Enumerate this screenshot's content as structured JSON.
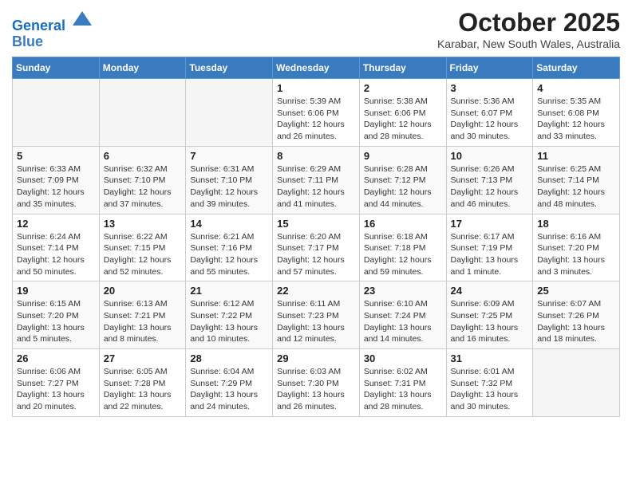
{
  "header": {
    "logo_line1": "General",
    "logo_line2": "Blue",
    "title": "October 2025",
    "location": "Karabar, New South Wales, Australia"
  },
  "weekdays": [
    "Sunday",
    "Monday",
    "Tuesday",
    "Wednesday",
    "Thursday",
    "Friday",
    "Saturday"
  ],
  "weeks": [
    [
      {
        "day": "",
        "info": ""
      },
      {
        "day": "",
        "info": ""
      },
      {
        "day": "",
        "info": ""
      },
      {
        "day": "1",
        "info": "Sunrise: 5:39 AM\nSunset: 6:06 PM\nDaylight: 12 hours\nand 26 minutes."
      },
      {
        "day": "2",
        "info": "Sunrise: 5:38 AM\nSunset: 6:06 PM\nDaylight: 12 hours\nand 28 minutes."
      },
      {
        "day": "3",
        "info": "Sunrise: 5:36 AM\nSunset: 6:07 PM\nDaylight: 12 hours\nand 30 minutes."
      },
      {
        "day": "4",
        "info": "Sunrise: 5:35 AM\nSunset: 6:08 PM\nDaylight: 12 hours\nand 33 minutes."
      }
    ],
    [
      {
        "day": "5",
        "info": "Sunrise: 6:33 AM\nSunset: 7:09 PM\nDaylight: 12 hours\nand 35 minutes."
      },
      {
        "day": "6",
        "info": "Sunrise: 6:32 AM\nSunset: 7:10 PM\nDaylight: 12 hours\nand 37 minutes."
      },
      {
        "day": "7",
        "info": "Sunrise: 6:31 AM\nSunset: 7:10 PM\nDaylight: 12 hours\nand 39 minutes."
      },
      {
        "day": "8",
        "info": "Sunrise: 6:29 AM\nSunset: 7:11 PM\nDaylight: 12 hours\nand 41 minutes."
      },
      {
        "day": "9",
        "info": "Sunrise: 6:28 AM\nSunset: 7:12 PM\nDaylight: 12 hours\nand 44 minutes."
      },
      {
        "day": "10",
        "info": "Sunrise: 6:26 AM\nSunset: 7:13 PM\nDaylight: 12 hours\nand 46 minutes."
      },
      {
        "day": "11",
        "info": "Sunrise: 6:25 AM\nSunset: 7:14 PM\nDaylight: 12 hours\nand 48 minutes."
      }
    ],
    [
      {
        "day": "12",
        "info": "Sunrise: 6:24 AM\nSunset: 7:14 PM\nDaylight: 12 hours\nand 50 minutes."
      },
      {
        "day": "13",
        "info": "Sunrise: 6:22 AM\nSunset: 7:15 PM\nDaylight: 12 hours\nand 52 minutes."
      },
      {
        "day": "14",
        "info": "Sunrise: 6:21 AM\nSunset: 7:16 PM\nDaylight: 12 hours\nand 55 minutes."
      },
      {
        "day": "15",
        "info": "Sunrise: 6:20 AM\nSunset: 7:17 PM\nDaylight: 12 hours\nand 57 minutes."
      },
      {
        "day": "16",
        "info": "Sunrise: 6:18 AM\nSunset: 7:18 PM\nDaylight: 12 hours\nand 59 minutes."
      },
      {
        "day": "17",
        "info": "Sunrise: 6:17 AM\nSunset: 7:19 PM\nDaylight: 13 hours\nand 1 minute."
      },
      {
        "day": "18",
        "info": "Sunrise: 6:16 AM\nSunset: 7:20 PM\nDaylight: 13 hours\nand 3 minutes."
      }
    ],
    [
      {
        "day": "19",
        "info": "Sunrise: 6:15 AM\nSunset: 7:20 PM\nDaylight: 13 hours\nand 5 minutes."
      },
      {
        "day": "20",
        "info": "Sunrise: 6:13 AM\nSunset: 7:21 PM\nDaylight: 13 hours\nand 8 minutes."
      },
      {
        "day": "21",
        "info": "Sunrise: 6:12 AM\nSunset: 7:22 PM\nDaylight: 13 hours\nand 10 minutes."
      },
      {
        "day": "22",
        "info": "Sunrise: 6:11 AM\nSunset: 7:23 PM\nDaylight: 13 hours\nand 12 minutes."
      },
      {
        "day": "23",
        "info": "Sunrise: 6:10 AM\nSunset: 7:24 PM\nDaylight: 13 hours\nand 14 minutes."
      },
      {
        "day": "24",
        "info": "Sunrise: 6:09 AM\nSunset: 7:25 PM\nDaylight: 13 hours\nand 16 minutes."
      },
      {
        "day": "25",
        "info": "Sunrise: 6:07 AM\nSunset: 7:26 PM\nDaylight: 13 hours\nand 18 minutes."
      }
    ],
    [
      {
        "day": "26",
        "info": "Sunrise: 6:06 AM\nSunset: 7:27 PM\nDaylight: 13 hours\nand 20 minutes."
      },
      {
        "day": "27",
        "info": "Sunrise: 6:05 AM\nSunset: 7:28 PM\nDaylight: 13 hours\nand 22 minutes."
      },
      {
        "day": "28",
        "info": "Sunrise: 6:04 AM\nSunset: 7:29 PM\nDaylight: 13 hours\nand 24 minutes."
      },
      {
        "day": "29",
        "info": "Sunrise: 6:03 AM\nSunset: 7:30 PM\nDaylight: 13 hours\nand 26 minutes."
      },
      {
        "day": "30",
        "info": "Sunrise: 6:02 AM\nSunset: 7:31 PM\nDaylight: 13 hours\nand 28 minutes."
      },
      {
        "day": "31",
        "info": "Sunrise: 6:01 AM\nSunset: 7:32 PM\nDaylight: 13 hours\nand 30 minutes."
      },
      {
        "day": "",
        "info": ""
      }
    ]
  ]
}
